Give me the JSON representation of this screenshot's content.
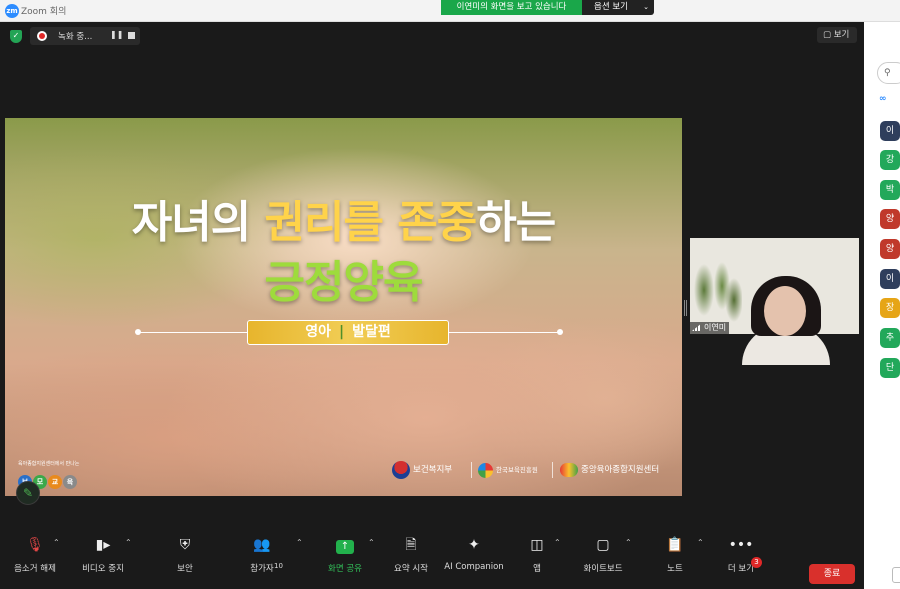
{
  "window": {
    "app_logo": "zm",
    "title": "Zoom 회의"
  },
  "share_banner": {
    "text": "이연미의 화면을 보고 있습니다",
    "options_label": "옵션 보기"
  },
  "top_bar": {
    "recording_label": "녹화 중...",
    "view_label": "보기"
  },
  "slide": {
    "title_line1_pre": "자녀의 ",
    "title_line1_hl1": "권리를",
    "title_line1_mid": " ",
    "title_line1_hl2": "존중",
    "title_line1_post": "하는",
    "title_line2": "긍정양육",
    "tag_left": "영아",
    "tag_sep": "|",
    "tag_right": "발달편",
    "brand_caption": "육아종합지원센터에서 만나는",
    "brand_badges": [
      "브",
      "모",
      "교",
      "육"
    ],
    "logo1": "보건복지부",
    "logo2": "한국보육진흥원",
    "logo3": "중앙육아종합지원센터"
  },
  "participant_tile": {
    "name": "이연미"
  },
  "toolbar": {
    "items": [
      {
        "label": "음소거 해제",
        "icon": "mic-off-icon"
      },
      {
        "label": "비디오 중지",
        "icon": "video-icon"
      },
      {
        "label": "보안",
        "icon": "shield-icon"
      },
      {
        "label": "참가자",
        "icon": "participants-icon",
        "count": "10"
      },
      {
        "label": "화면 공유",
        "icon": "share-screen-icon"
      },
      {
        "label": "요약 시작",
        "icon": "summary-icon"
      },
      {
        "label": "AI Companion",
        "icon": "sparkle-icon"
      },
      {
        "label": "앱",
        "icon": "apps-icon"
      },
      {
        "label": "화이트보드",
        "icon": "whiteboard-icon"
      },
      {
        "label": "노트",
        "icon": "notes-icon"
      },
      {
        "label": "더 보기",
        "icon": "more-icon",
        "badge": "3"
      }
    ],
    "end_label": "종료"
  },
  "side_panel": {
    "avatars": [
      {
        "initial": "이",
        "color": "#2f3e5c"
      },
      {
        "initial": "강",
        "color": "#22a85a"
      },
      {
        "initial": "박",
        "color": "#22a85a"
      },
      {
        "initial": "양",
        "color": "#c0392b"
      },
      {
        "initial": "양",
        "color": "#c0392b"
      },
      {
        "initial": "이",
        "color": "#2f3e5c"
      },
      {
        "initial": "장",
        "color": "#e6a517"
      },
      {
        "initial": "추",
        "color": "#22a85a"
      },
      {
        "initial": "단",
        "color": "#22a85a"
      }
    ]
  }
}
